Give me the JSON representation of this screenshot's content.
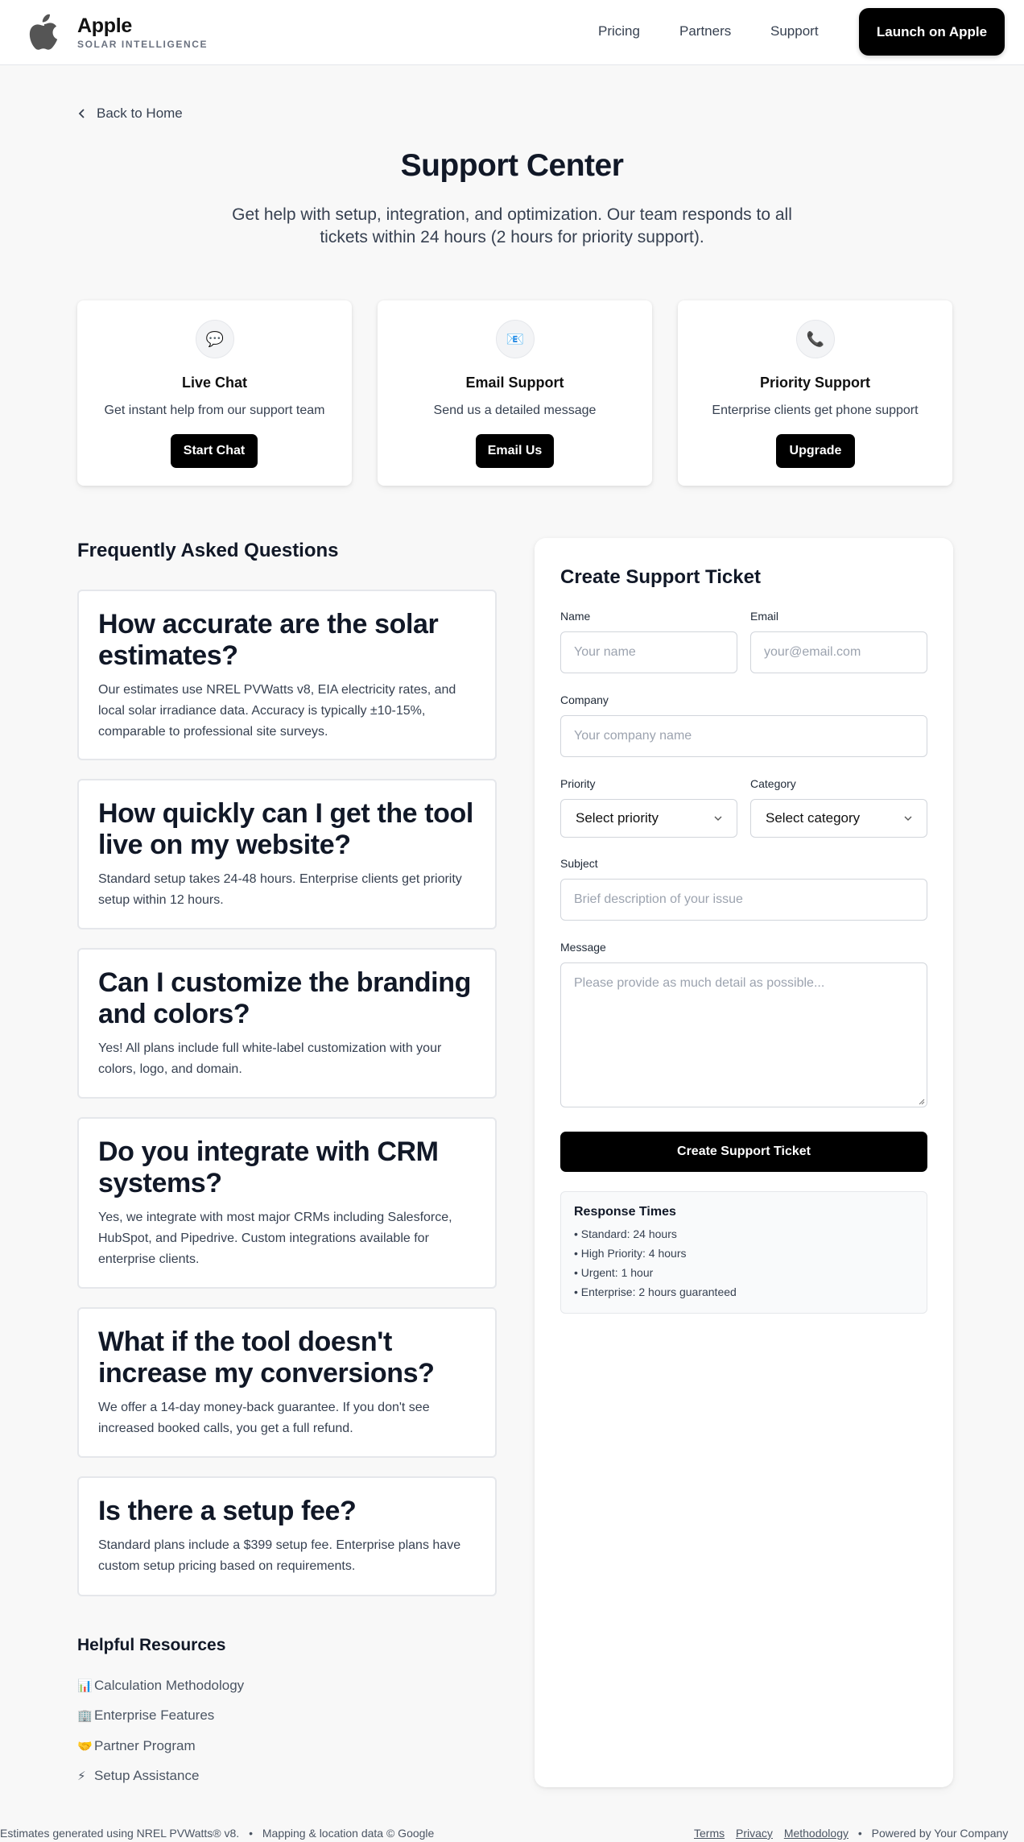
{
  "header": {
    "brand_name": "Apple",
    "brand_sub": "SOLAR INTELLIGENCE",
    "nav": [
      "Pricing",
      "Partners",
      "Support"
    ],
    "launch_label": "Launch on Apple"
  },
  "back_label": "Back to Home",
  "page": {
    "title": "Support Center",
    "subtitle": "Get help with setup, integration, and optimization. Our team responds to all tickets within 24 hours (2 hours for priority support)."
  },
  "cards": [
    {
      "icon": "chat-bubble-icon",
      "glyph": "💬",
      "title": "Live Chat",
      "desc": "Get instant help from our support team",
      "button": "Start Chat"
    },
    {
      "icon": "envelope-icon",
      "glyph": "📧",
      "title": "Email Support",
      "desc": "Send us a detailed message",
      "button": "Email Us"
    },
    {
      "icon": "phone-icon",
      "glyph": "📞",
      "title": "Priority Support",
      "desc": "Enterprise clients get phone support",
      "button": "Upgrade"
    }
  ],
  "faq": {
    "heading": "Frequently Asked Questions",
    "items": [
      {
        "q": "How accurate are the solar estimates?",
        "a": "Our estimates use NREL PVWatts v8, EIA electricity rates, and local solar irradiance data. Accuracy is typically ±10-15%, comparable to professional site surveys."
      },
      {
        "q": "How quickly can I get the tool live on my website?",
        "a": "Standard setup takes 24-48 hours. Enterprise clients get priority setup within 12 hours."
      },
      {
        "q": "Can I customize the branding and colors?",
        "a": "Yes! All plans include full white-label customization with your colors, logo, and domain."
      },
      {
        "q": "Do you integrate with CRM systems?",
        "a": "Yes, we integrate with most major CRMs including Salesforce, HubSpot, and Pipedrive. Custom integrations available for enterprise clients."
      },
      {
        "q": "What if the tool doesn't increase my conversions?",
        "a": "We offer a 14-day money-back guarantee. If you don't see increased booked calls, you get a full refund."
      },
      {
        "q": "Is there a setup fee?",
        "a": "Standard plans include a $399 setup fee. Enterprise plans have custom setup pricing based on requirements."
      }
    ]
  },
  "resources": {
    "heading": "Helpful Resources",
    "links": [
      {
        "emoji": "📊",
        "label": "Calculation Methodology"
      },
      {
        "emoji": "🏢",
        "label": "Enterprise Features"
      },
      {
        "emoji": "🤝",
        "label": "Partner Program"
      },
      {
        "emoji": "⚡",
        "label": "Setup Assistance"
      }
    ]
  },
  "ticket": {
    "title": "Create Support Ticket",
    "name_label": "Name",
    "name_placeholder": "Your name",
    "email_label": "Email",
    "email_placeholder": "your@email.com",
    "company_label": "Company",
    "company_placeholder": "Your company name",
    "priority_label": "Priority",
    "priority_value": "Select priority",
    "category_label": "Category",
    "category_value": "Select category",
    "subject_label": "Subject",
    "subject_placeholder": "Brief description of your issue",
    "message_label": "Message",
    "message_placeholder": "Please provide as much detail as possible...",
    "submit_label": "Create Support Ticket",
    "response": {
      "title": "Response Times",
      "items": [
        "• Standard: 24 hours",
        "• High Priority: 4 hours",
        "• Urgent: 1 hour",
        "• Enterprise: 2 hours guaranteed"
      ]
    }
  },
  "footer": {
    "left_text": "Estimates generated using NREL PVWatts® v8.",
    "left_sep": "•",
    "left_text2": "Mapping & location data © Google",
    "links": [
      "Terms",
      "Privacy",
      "Methodology"
    ],
    "right_sep": "•",
    "powered": "Powered by Your Company"
  }
}
